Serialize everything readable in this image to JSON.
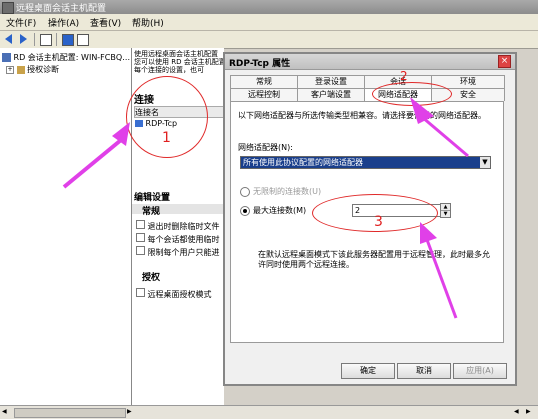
{
  "window": {
    "title": "远程桌面会话主机配置"
  },
  "menu": [
    "文件(F)",
    "操作(A)",
    "查看(V)",
    "帮助(H)"
  ],
  "tree": {
    "root": "RD 会话主机配置: WIN-FCBQ…",
    "child": "授权诊断"
  },
  "middle": {
    "desc": [
      "使用远程桌面会话主机配置",
      "您可以使用 RD 会话主机配置",
      "每个连接的设置，也可"
    ],
    "connections_title": "连接",
    "col_connection": "连接名",
    "connection_item": "RDP-Tcp",
    "edit_settings_title": "编辑设置",
    "general_title": "常规",
    "general_items": [
      "退出时删除临时文件",
      "每个会话都使用临时",
      "限制每个用户只能进"
    ],
    "licensing_title": "授权",
    "licensing_item": "远程桌面授权模式"
  },
  "dialog": {
    "title": "RDP-Tcp 属性",
    "tabs_row1": [
      "常规",
      "登录设置",
      "会话",
      "环境"
    ],
    "tabs_row2": [
      "远程控制",
      "客户端设置",
      "网络适配器",
      "安全"
    ],
    "description": "以下网络适配器与所选传输类型相兼容。请选择要使用的网络适配器。",
    "adapter_label": "网络适配器(N):",
    "adapter_value": "所有使用此协议配置的网络适配器",
    "radio_unlimited": "无限制的连接数(U)",
    "radio_max": "最大连接数(M)",
    "max_value": "2",
    "note": "在默认远程桌面模式下该此服务器配置用于远程管理，此时最多允许同时使用两个远程连接。",
    "buttons": {
      "ok": "确定",
      "cancel": "取消",
      "apply": "应用(A)"
    }
  },
  "annotations": [
    "1",
    "2",
    "3"
  ],
  "colors": {
    "annotation": "#e02a2a",
    "arrow": "#e040e8",
    "select_bg": "#1a3f8c"
  }
}
